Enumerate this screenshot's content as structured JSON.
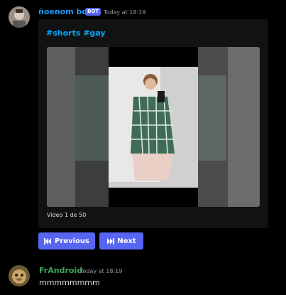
{
  "messages": [
    {
      "author": "ñoenom bot",
      "author_color": "#1e9bff",
      "badge": "BOT",
      "timestamp": "Today at 18:19",
      "embed": {
        "title": "#shorts #gay",
        "footer": "Video 1 de 50"
      },
      "buttons": {
        "previous_label": "Previous",
        "next_label": "Next"
      }
    },
    {
      "author": "FrAndroid",
      "author_color": "#3ba55c",
      "timestamp": "Today at 18:19",
      "content": "mmmmmmmm"
    }
  ],
  "colors": {
    "background": "#000000",
    "embed_background": "#111214",
    "link": "#00a8fc",
    "button": "#5865f2"
  },
  "icons": {
    "previous": "skip-back-icon",
    "next": "skip-forward-icon"
  }
}
